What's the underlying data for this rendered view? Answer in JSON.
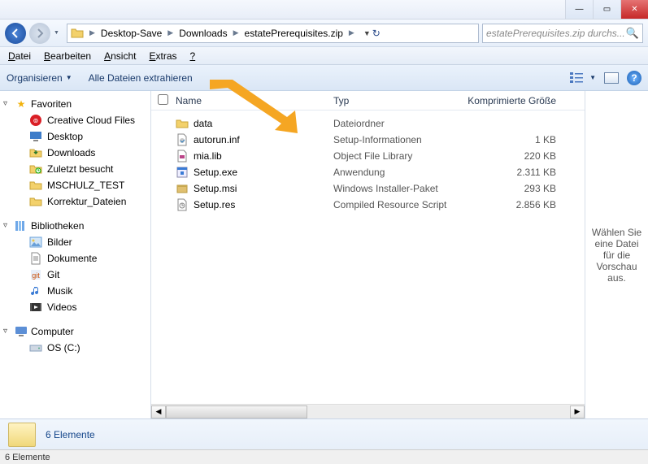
{
  "titlebar": {
    "min": "—",
    "max": "▭",
    "close": "✕"
  },
  "nav": {
    "breadcrumb": [
      "Desktop-Save",
      "Downloads",
      "estatePrerequisites.zip"
    ],
    "search_placeholder": "estatePrerequisites.zip durchs..."
  },
  "menu": {
    "file": "Datei",
    "edit": "Bearbeiten",
    "view": "Ansicht",
    "extras": "Extras",
    "help": "?"
  },
  "toolbar": {
    "organize": "Organisieren",
    "extract": "Alle Dateien extrahieren"
  },
  "sidebar": {
    "favorites": {
      "label": "Favoriten",
      "items": [
        {
          "icon": "cc",
          "label": "Creative Cloud Files"
        },
        {
          "icon": "desktop",
          "label": "Desktop"
        },
        {
          "icon": "downloads",
          "label": "Downloads"
        },
        {
          "icon": "recent",
          "label": "Zuletzt besucht"
        },
        {
          "icon": "folder",
          "label": "MSCHULZ_TEST"
        },
        {
          "icon": "folder",
          "label": "Korrektur_Dateien"
        }
      ]
    },
    "libraries": {
      "label": "Bibliotheken",
      "items": [
        {
          "icon": "pictures",
          "label": "Bilder"
        },
        {
          "icon": "documents",
          "label": "Dokumente"
        },
        {
          "icon": "git",
          "label": "Git"
        },
        {
          "icon": "music",
          "label": "Musik"
        },
        {
          "icon": "videos",
          "label": "Videos"
        }
      ]
    },
    "computer": {
      "label": "Computer",
      "items": [
        {
          "icon": "drive",
          "label": "OS (C:)"
        }
      ]
    }
  },
  "columns": {
    "name": "Name",
    "type": "Typ",
    "size": "Komprimierte Größe"
  },
  "files": [
    {
      "icon": "folder",
      "name": "data",
      "type": "Dateiordner",
      "size": ""
    },
    {
      "icon": "inf",
      "name": "autorun.inf",
      "type": "Setup-Informationen",
      "size": "1 KB"
    },
    {
      "icon": "lib",
      "name": "mia.lib",
      "type": "Object File Library",
      "size": "220 KB"
    },
    {
      "icon": "exe",
      "name": "Setup.exe",
      "type": "Anwendung",
      "size": "2.311 KB"
    },
    {
      "icon": "msi",
      "name": "Setup.msi",
      "type": "Windows Installer-Paket",
      "size": "293 KB"
    },
    {
      "icon": "res",
      "name": "Setup.res",
      "type": "Compiled Resource Script",
      "size": "2.856 KB"
    }
  ],
  "preview_hint": "Wählen Sie eine Datei für die Vorschau aus.",
  "details": {
    "count": "6 Elemente"
  },
  "status": {
    "text": "6 Elemente"
  }
}
